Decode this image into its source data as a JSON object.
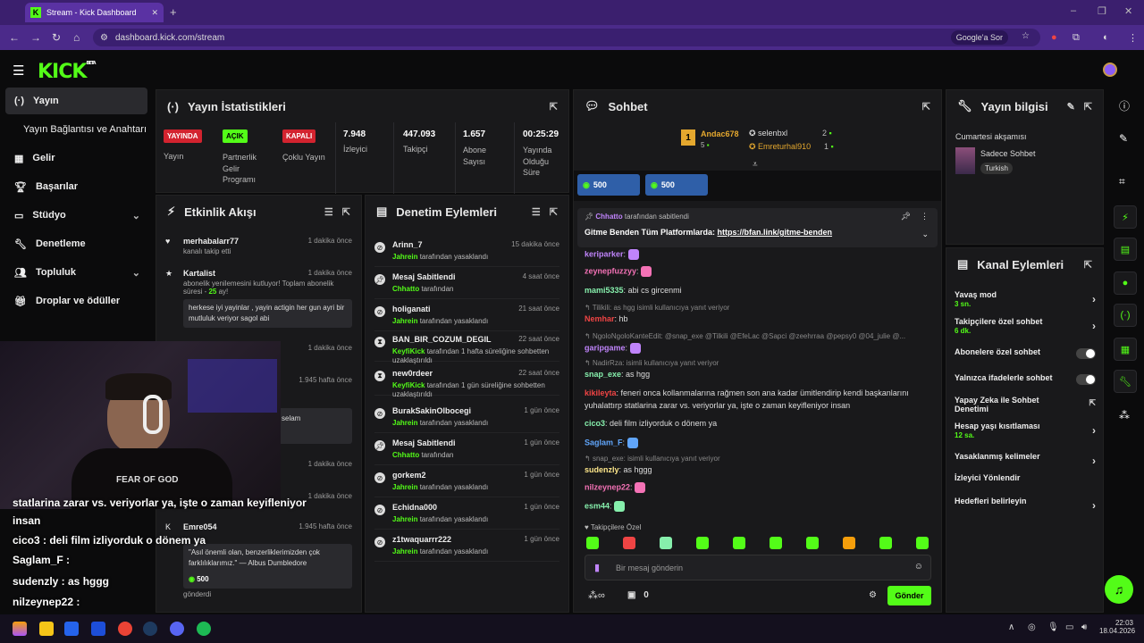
{
  "browser": {
    "tab_title": "Stream - Kick Dashboard",
    "url": "dashboard.kick.com/stream",
    "google_pill": "Google'a Sor"
  },
  "app": {
    "logo": "KICK",
    "logo_beta": "BETA"
  },
  "sidebar": {
    "items": [
      {
        "label": "Yayın",
        "icon": "broadcast-icon",
        "active": true
      },
      {
        "label": "Yayın Bağlantısı ve Anahtarı",
        "icon": "",
        "active": false
      },
      {
        "label": "Gelir",
        "icon": "revenue-icon"
      },
      {
        "label": "Başarılar",
        "icon": "trophy-icon"
      },
      {
        "label": "Stüdyo",
        "icon": "studio-icon",
        "expandable": true
      },
      {
        "label": "Denetleme",
        "icon": "wrench-icon"
      },
      {
        "label": "Topluluk",
        "icon": "community-icon",
        "expandable": true
      },
      {
        "label": "Droplar ve ödüller",
        "icon": "gift-icon"
      }
    ]
  },
  "stats": {
    "title": "Yayın İstatistikleri",
    "live_badge": "YAYINDA",
    "live_label": "Yayın",
    "partner_badge": "AÇIK",
    "partner_label": "Partnerlik Gelir Programı",
    "multi_badge": "KAPALI",
    "multi_label": "Çoklu Yayın",
    "viewers": "7.948",
    "viewers_label": "İzleyici",
    "followers": "447.093",
    "followers_label": "Takipçi",
    "subs": "1.657",
    "subs_label": "Abone Sayısı",
    "uptime": "00:25:29",
    "uptime_label": "Yayında Olduğu Süre"
  },
  "activity": {
    "title": "Etkinlik Akışı",
    "items": [
      {
        "name": "merhabalarr77",
        "time": "1 dakika önce",
        "sub": "kanalı takip etti"
      },
      {
        "name": "Kartalist",
        "time": "1 dakika önce",
        "sub": "abonelik yenilemesini kutluyor! Toplam abonelik süresi - ",
        "months": "25",
        "sub2": " ay!",
        "msg": "herkese iyi yayinlar , yayin actigin her gun ayri bir mutluluk veriyor sagol abi"
      },
      {
        "time": "1 dakika önce"
      },
      {
        "time": "1.945 hafta önce",
        "msg": "selam"
      },
      {
        "time": "1 dakika önce"
      },
      {
        "time": "1 dakika önce"
      },
      {
        "name": "Emre054",
        "time": "1.945 hafta önce",
        "msg": "\"Asıl önemli olan, benzerliklerimizden çok farklılıklarımız.\" — Albus Dumbledore",
        "amount": "500",
        "footer": "gönderdi"
      }
    ]
  },
  "moderation": {
    "title": "Denetim Eylemleri",
    "items": [
      {
        "name": "Arinn_7",
        "time": "15 dakika önce",
        "by": "Jahrein",
        "action": "tarafından yasaklandı",
        "icon": "ban-icon"
      },
      {
        "name": "Mesaj Sabitlendi",
        "time": "4 saat önce",
        "by": "Chhatto",
        "action": "tarafından",
        "icon": "pin-icon"
      },
      {
        "name": "holiganati",
        "time": "21 saat önce",
        "by": "Jahrein",
        "action": "tarafından yasaklandı",
        "icon": "ban-icon"
      },
      {
        "name": "BAN_BIR_COZUM_DEGIL",
        "time": "22 saat önce",
        "by": "KeyfiKick",
        "action": "tarafından 1 hafta süreliğine sohbetten uzaklaştırıldı",
        "icon": "hourglass-icon"
      },
      {
        "name": "new0rdeer",
        "time": "22 saat önce",
        "by": "KeyfiKick",
        "action": "tarafından 1 gün süreliğine sohbetten uzaklaştırıldı",
        "icon": "hourglass-icon"
      },
      {
        "name": "BurakSakinOlbocegi",
        "time": "1 gün önce",
        "by": "Jahrein",
        "action": "tarafından yasaklandı",
        "icon": "ban-icon"
      },
      {
        "name": "Mesaj Sabitlendi",
        "time": "1 gün önce",
        "by": "Chhatto",
        "action": "tarafından",
        "icon": "pin-icon"
      },
      {
        "name": "gorkem2",
        "time": "1 gün önce",
        "by": "Jahrein",
        "action": "tarafından yasaklandı",
        "icon": "ban-icon"
      },
      {
        "name": "Echidna000",
        "time": "1 gün önce",
        "by": "Jahrein",
        "action": "tarafından yasaklandı",
        "icon": "ban-icon"
      },
      {
        "name": "z1twaquarrr222",
        "time": "1 gün önce",
        "by": "Jahrein",
        "action": "tarafından yasaklandı",
        "icon": "ban-icon"
      }
    ]
  },
  "chat": {
    "title": "Sohbet",
    "top1": "Andac678",
    "top1_count": "5",
    "top2": "selenbxl",
    "top2_count": "2",
    "top3": "Emreturhal910",
    "top3_count": "1",
    "goal1": "500",
    "goal2": "500",
    "pinned_by": "Chhatto",
    "pinned_label": "tarafından sabitlendi",
    "pinned_text": "Gitme Benden Tüm Platformlarda: ",
    "pinned_link": "https://bfan.link/gitme-benden",
    "lines": [
      {
        "user": "keriparker",
        "color": "#c084fc",
        "text": ""
      },
      {
        "user": "zeynepfuzzyy",
        "color": "#f472b6",
        "text": ""
      },
      {
        "user": "mami5335",
        "color": "#86efac",
        "text": " abi cs gircenmi"
      },
      {
        "reply": "Tilikili: as hgg isimli kullanıcıya yanıt veriyor"
      },
      {
        "user": "Nemhar",
        "color": "#ef4444",
        "text": " hb"
      },
      {
        "reply": "NgoloNgoloKanteEdit: @snap_exe @Tilkili @EfeLac @Sapci @zeehrraa @pepsy0 @04_julie @..."
      },
      {
        "user": "garipgame",
        "color": "#c084fc",
        "text": ""
      },
      {
        "reply": "NadirRza: isimli kullanıcıya yanıt veriyor"
      },
      {
        "user": "snap_exe",
        "color": "#86efac",
        "text": " as hgg"
      },
      {
        "user": "kikileyta",
        "color": "#ef4444",
        "text": " feneri onca kollanmalarına rağmen son ana kadar ümitlendirip kendi başkanlarını"
      },
      {
        "cont": "yuhalattırp statlarina zarar vs. veriyorlar ya, işte o zaman keyifleniyor insan"
      },
      {
        "user": "cico3",
        "color": "#86efac",
        "text": " deli film izliyorduk o dönem ya"
      },
      {
        "user": "Saglam_F",
        "color": "#60a5fa",
        "text": ""
      },
      {
        "reply": "snap_exe: isimli kullanıcıya yanıt veriyor"
      },
      {
        "user": "sudenzly",
        "color": "#fde68a",
        "text": " as hggg"
      },
      {
        "user": "nilzeynep22",
        "color": "#f472b6",
        "text": ""
      },
      {
        "user": "esm44",
        "color": "#86efac",
        "text": ""
      }
    ],
    "followers_only": "Takipçilere Özel",
    "input_placeholder": "Bir mesaj gönderin",
    "points": "0",
    "send": "Gönder"
  },
  "stream_info": {
    "title": "Yayın bilgisi",
    "stream_title": "Cumartesi akşamısı",
    "category": "Sadece Sohbet",
    "language": "Turkish"
  },
  "channel_actions": {
    "title": "Kanal Eylemleri",
    "items": [
      {
        "label": "Yavaş mod",
        "sub": "3 sn.",
        "type": "chev"
      },
      {
        "label": "Takipçilere özel sohbet",
        "sub": "6 dk.",
        "type": "chev"
      },
      {
        "label": "Abonelere özel sohbet",
        "type": "toggle"
      },
      {
        "label": "Yalnızca ifadelerle sohbet",
        "type": "toggle"
      },
      {
        "label": "Yapay Zeka ile Sohbet Denetimi",
        "type": "ext"
      },
      {
        "label": "Hesap yaşı kısıtlaması",
        "sub": "12 sa.",
        "type": "chev"
      },
      {
        "label": "Yasaklanmış kelimeler",
        "type": "chev"
      },
      {
        "label": "İzleyici Yönlendir",
        "type": "none"
      },
      {
        "label": "Hedefleri belirleyin",
        "type": "chev"
      }
    ]
  },
  "overlay": {
    "lines": [
      "statlarina zarar vs. veriyorlar ya, işte o zaman keyifleniyor",
      "insan",
      "cico3 : deli film izliyorduk o dönem ya",
      "Saglam_F :",
      "sudenzly : as hggg",
      "nilzeynep22 :"
    ],
    "shirt": "FEAR OF GOD"
  },
  "taskbar": {
    "time": "22:03",
    "date": "18.04.2026"
  },
  "colors": {
    "accent": "#53fc18",
    "bg": "#0b0b0c",
    "panel": "#19191b",
    "chrome": "#4b2a8a"
  }
}
